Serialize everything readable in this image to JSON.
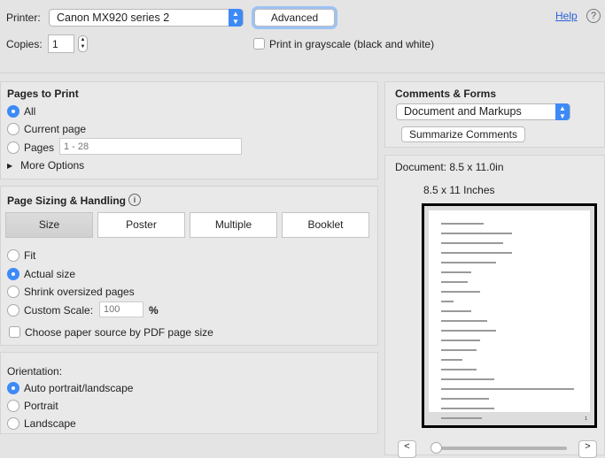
{
  "top": {
    "printer_label": "Printer:",
    "printer_value": "Canon MX920 series 2",
    "advanced": "Advanced",
    "help": "Help",
    "copies_label": "Copies:",
    "copies_value": "1",
    "grayscale_label": "Print in grayscale (black and white)",
    "grayscale_checked": false
  },
  "pages": {
    "title": "Pages to Print",
    "options": [
      "All",
      "Current page",
      "Pages"
    ],
    "selected": "All",
    "pages_placeholder": "1 - 28",
    "more": "More Options"
  },
  "sizing": {
    "title": "Page Sizing & Handling",
    "tabs": [
      "Size",
      "Poster",
      "Multiple",
      "Booklet"
    ],
    "active_tab": "Size",
    "options": [
      "Fit",
      "Actual size",
      "Shrink oversized pages",
      "Custom Scale:"
    ],
    "selected": "Actual size",
    "scale_placeholder": "100",
    "percent": "%",
    "paper_source": "Choose paper source by PDF page size",
    "paper_source_checked": false
  },
  "orientation": {
    "title": "Orientation:",
    "options": [
      "Auto portrait/landscape",
      "Portrait",
      "Landscape"
    ],
    "selected": "Auto portrait/landscape"
  },
  "comments": {
    "title": "Comments & Forms",
    "value": "Document and Markups",
    "summarize": "Summarize Comments"
  },
  "preview": {
    "document": "Document: 8.5 x 11.0in",
    "paper": "8.5 x 11 Inches",
    "page_number": "1",
    "prev": "<",
    "next": ">"
  },
  "colors": {
    "accent": "#3d8af7"
  }
}
